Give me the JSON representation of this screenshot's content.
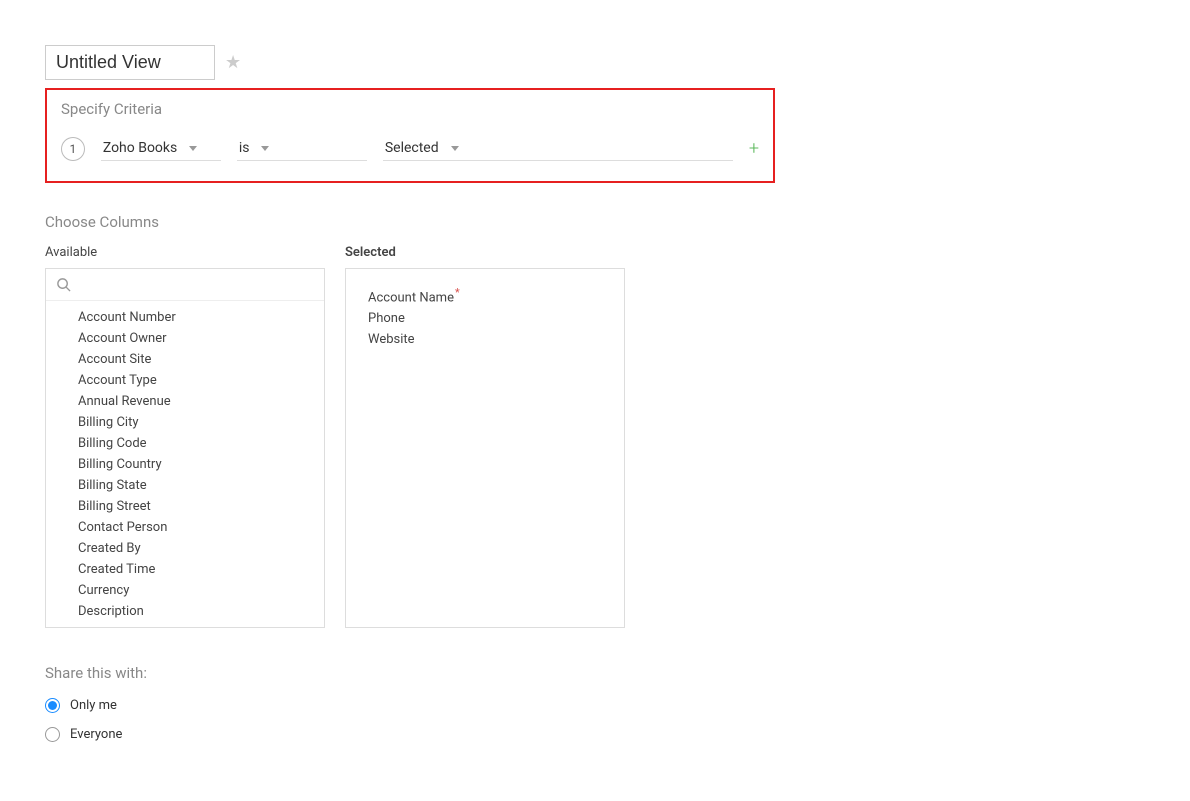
{
  "viewTitle": "Untitled View",
  "criteria": {
    "heading": "Specify Criteria",
    "rowNumber": "1",
    "field": "Zoho Books",
    "operator": "is",
    "value": "Selected"
  },
  "columns": {
    "heading": "Choose Columns",
    "availableLabel": "Available",
    "selectedLabel": "Selected",
    "available": [
      "Account Number",
      "Account Owner",
      "Account Site",
      "Account Type",
      "Annual Revenue",
      "Billing City",
      "Billing Code",
      "Billing Country",
      "Billing State",
      "Billing Street",
      "Contact Person",
      "Created By",
      "Created Time",
      "Currency",
      "Description"
    ],
    "selected": [
      {
        "label": "Account Name",
        "required": true
      },
      {
        "label": "Phone",
        "required": false
      },
      {
        "label": "Website",
        "required": false
      }
    ]
  },
  "share": {
    "heading": "Share this with:",
    "options": [
      {
        "label": "Only me",
        "checked": true
      },
      {
        "label": "Everyone",
        "checked": false
      }
    ]
  }
}
